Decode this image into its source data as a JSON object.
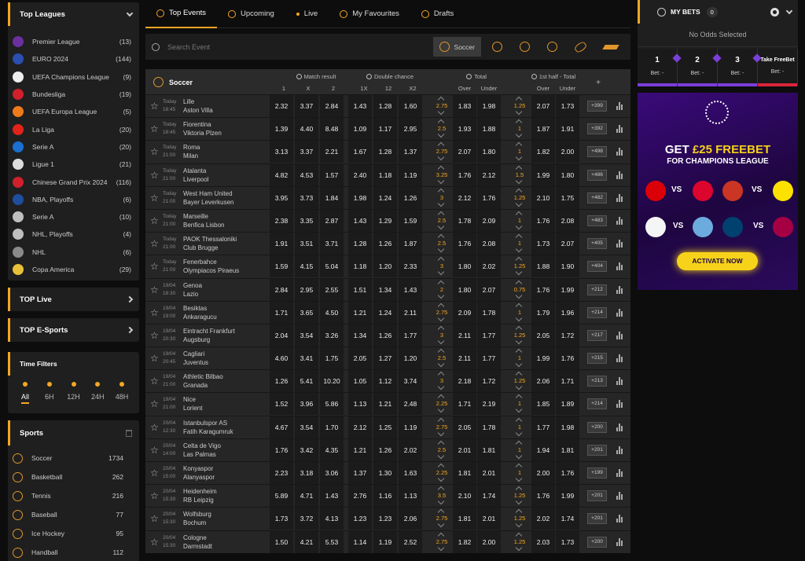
{
  "top_leagues": {
    "title": "Top Leagues",
    "items": [
      {
        "name": "Premier League",
        "count": "(13)",
        "color": "#6b2fa0"
      },
      {
        "name": "EURO 2024",
        "count": "(144)",
        "color": "#2a4fb0"
      },
      {
        "name": "UEFA Champions League",
        "count": "(9)",
        "color": "#eeeeee"
      },
      {
        "name": "Bundesliga",
        "count": "(19)",
        "color": "#d0202a"
      },
      {
        "name": "UEFA Europa League",
        "count": "(5)",
        "color": "#f07a1a"
      },
      {
        "name": "La Liga",
        "count": "(20)",
        "color": "#e2231a"
      },
      {
        "name": "Serie A",
        "count": "(20)",
        "color": "#1a6fd0"
      },
      {
        "name": "Ligue 1",
        "count": "(21)",
        "color": "#dddddd"
      },
      {
        "name": "Chinese Grand Prix 2024",
        "count": "(116)",
        "color": "#d0202a"
      },
      {
        "name": "NBA, Playoffs",
        "count": "(6)",
        "color": "#1d4f9e"
      },
      {
        "name": "Serie A",
        "count": "(10)",
        "color": "#bfbfbf"
      },
      {
        "name": "NHL, Playoffs",
        "count": "(4)",
        "color": "#bfbfbf"
      },
      {
        "name": "NHL",
        "count": "(6)",
        "color": "#8a8a8a"
      },
      {
        "name": "Copa America",
        "count": "(29)",
        "color": "#e8c13a"
      }
    ]
  },
  "top_live": {
    "title": "TOP Live"
  },
  "top_esports": {
    "title": "TOP E-Sports"
  },
  "time_filters": {
    "title": "Time Filters",
    "options": [
      "All",
      "6H",
      "12H",
      "24H",
      "48H"
    ]
  },
  "sports": {
    "title": "Sports",
    "items": [
      {
        "name": "Soccer",
        "count": "1734"
      },
      {
        "name": "Basketball",
        "count": "262"
      },
      {
        "name": "Tennis",
        "count": "216"
      },
      {
        "name": "Baseball",
        "count": "77"
      },
      {
        "name": "Ice Hockey",
        "count": "95"
      },
      {
        "name": "Handball",
        "count": "112"
      }
    ]
  },
  "tabs": [
    "Top Events",
    "Upcoming",
    "Live",
    "My Favourites",
    "Drafts"
  ],
  "search": {
    "placeholder": "Search Event"
  },
  "sport_filter": {
    "active": "Soccer"
  },
  "table": {
    "sport": "Soccer",
    "groups": [
      "Match result",
      "Double chance",
      "Total",
      "1st half - Total"
    ],
    "subheaders": [
      "1",
      "X",
      "2",
      "1X",
      "12",
      "X2",
      "Over",
      "Under",
      "Over",
      "Under"
    ],
    "plus": "+",
    "rows": [
      {
        "date": "Today",
        "time": "18:45",
        "home": "Lille",
        "away": "Aston Villa",
        "o1": "2.32",
        "ox": "3.37",
        "o2": "2.84",
        "d1x": "1.43",
        "d12": "1.28",
        "dx2": "1.60",
        "t": "2.75",
        "to": "1.83",
        "tu": "1.98",
        "h": "1.25",
        "ho": "2.07",
        "hu": "1.73",
        "more": "+399"
      },
      {
        "date": "Today",
        "time": "18:45",
        "home": "Fiorentina",
        "away": "Viktoria Plzen",
        "o1": "1.39",
        "ox": "4.40",
        "o2": "8.48",
        "d1x": "1.09",
        "d12": "1.17",
        "dx2": "2.95",
        "t": "2.5",
        "to": "1.93",
        "tu": "1.88",
        "h": "1",
        "ho": "1.87",
        "hu": "1.91",
        "more": "+392"
      },
      {
        "date": "Today",
        "time": "21:00",
        "home": "Roma",
        "away": "Milan",
        "o1": "3.13",
        "ox": "3.37",
        "o2": "2.21",
        "d1x": "1.67",
        "d12": "1.28",
        "dx2": "1.37",
        "t": "2.75",
        "to": "2.07",
        "tu": "1.80",
        "h": "1",
        "ho": "1.82",
        "hu": "2.00",
        "more": "+498"
      },
      {
        "date": "Today",
        "time": "21:00",
        "home": "Atalanta",
        "away": "Liverpool",
        "o1": "4.82",
        "ox": "4.53",
        "o2": "1.57",
        "d1x": "2.40",
        "d12": "1.18",
        "dx2": "1.19",
        "t": "3.25",
        "to": "1.76",
        "tu": "2.12",
        "h": "1.5",
        "ho": "1.99",
        "hu": "1.80",
        "more": "+486"
      },
      {
        "date": "Today",
        "time": "21:00",
        "home": "West Ham United",
        "away": "Bayer Leverkusen",
        "o1": "3.95",
        "ox": "3.73",
        "o2": "1.84",
        "d1x": "1.98",
        "d12": "1.24",
        "dx2": "1.26",
        "t": "3",
        "to": "2.12",
        "tu": "1.76",
        "h": "1.25",
        "ho": "2.10",
        "hu": "1.75",
        "more": "+482"
      },
      {
        "date": "Today",
        "time": "21:00",
        "home": "Marseille",
        "away": "Benfica Lisbon",
        "o1": "2.38",
        "ox": "3.35",
        "o2": "2.87",
        "d1x": "1.43",
        "d12": "1.29",
        "dx2": "1.59",
        "t": "2.5",
        "to": "1.78",
        "tu": "2.09",
        "h": "1",
        "ho": "1.76",
        "hu": "2.08",
        "more": "+483"
      },
      {
        "date": "Today",
        "time": "21:00",
        "home": "PAOK Thessaloniki",
        "away": "Club Brugge",
        "o1": "1.91",
        "ox": "3.51",
        "o2": "3.71",
        "d1x": "1.28",
        "d12": "1.26",
        "dx2": "1.87",
        "t": "2.5",
        "to": "1.76",
        "tu": "2.08",
        "h": "1",
        "ho": "1.73",
        "hu": "2.07",
        "more": "+405"
      },
      {
        "date": "Today",
        "time": "21:00",
        "home": "Fenerbahce",
        "away": "Olympiacos Piraeus",
        "o1": "1.59",
        "ox": "4.15",
        "o2": "5.04",
        "d1x": "1.18",
        "d12": "1.20",
        "dx2": "2.33",
        "t": "3",
        "to": "1.80",
        "tu": "2.02",
        "h": "1.25",
        "ho": "1.88",
        "hu": "1.90",
        "more": "+404"
      },
      {
        "date": "19/04",
        "time": "18:30",
        "home": "Genoa",
        "away": "Lazio",
        "o1": "2.84",
        "ox": "2.95",
        "o2": "2.55",
        "d1x": "1.51",
        "d12": "1.34",
        "dx2": "1.43",
        "t": "2",
        "to": "1.80",
        "tu": "2.07",
        "h": "0.75",
        "ho": "1.76",
        "hu": "1.99",
        "more": "+212"
      },
      {
        "date": "19/04",
        "time": "19:00",
        "home": "Besiktas",
        "away": "Ankaragucu",
        "o1": "1.71",
        "ox": "3.65",
        "o2": "4.50",
        "d1x": "1.21",
        "d12": "1.24",
        "dx2": "2.11",
        "t": "2.75",
        "to": "2.09",
        "tu": "1.78",
        "h": "1",
        "ho": "1.79",
        "hu": "1.96",
        "more": "+214"
      },
      {
        "date": "19/04",
        "time": "20:30",
        "home": "Eintracht Frankfurt",
        "away": "Augsburg",
        "o1": "2.04",
        "ox": "3.54",
        "o2": "3.26",
        "d1x": "1.34",
        "d12": "1.26",
        "dx2": "1.77",
        "t": "3",
        "to": "2.11",
        "tu": "1.77",
        "h": "1.25",
        "ho": "2.05",
        "hu": "1.72",
        "more": "+217"
      },
      {
        "date": "19/04",
        "time": "20:45",
        "home": "Cagliari",
        "away": "Juventus",
        "o1": "4.60",
        "ox": "3.41",
        "o2": "1.75",
        "d1x": "2.05",
        "d12": "1.27",
        "dx2": "1.20",
        "t": "2.5",
        "to": "2.11",
        "tu": "1.77",
        "h": "1",
        "ho": "1.99",
        "hu": "1.76",
        "more": "+215"
      },
      {
        "date": "19/04",
        "time": "21:00",
        "home": "Athletic Bilbao",
        "away": "Granada",
        "o1": "1.26",
        "ox": "5.41",
        "o2": "10.20",
        "d1x": "1.05",
        "d12": "1.12",
        "dx2": "3.74",
        "t": "3",
        "to": "2.18",
        "tu": "1.72",
        "h": "1.25",
        "ho": "2.06",
        "hu": "1.71",
        "more": "+213"
      },
      {
        "date": "19/04",
        "time": "21:00",
        "home": "Nice",
        "away": "Lorient",
        "o1": "1.52",
        "ox": "3.96",
        "o2": "5.86",
        "d1x": "1.13",
        "d12": "1.21",
        "dx2": "2.48",
        "t": "2.25",
        "to": "1.71",
        "tu": "2.19",
        "h": "1",
        "ho": "1.85",
        "hu": "1.89",
        "more": "+214"
      },
      {
        "date": "20/04",
        "time": "12:30",
        "home": "Istanbulspor AS",
        "away": "Fatih Karagumruk",
        "o1": "4.67",
        "ox": "3.54",
        "o2": "1.70",
        "d1x": "2.12",
        "d12": "1.25",
        "dx2": "1.19",
        "t": "2.75",
        "to": "2.05",
        "tu": "1.78",
        "h": "1",
        "ho": "1.77",
        "hu": "1.98",
        "more": "+200"
      },
      {
        "date": "20/04",
        "time": "14:00",
        "home": "Celta de Vigo",
        "away": "Las Palmas",
        "o1": "1.76",
        "ox": "3.42",
        "o2": "4.35",
        "d1x": "1.21",
        "d12": "1.26",
        "dx2": "2.02",
        "t": "2.5",
        "to": "2.01",
        "tu": "1.81",
        "h": "1",
        "ho": "1.94",
        "hu": "1.81",
        "more": "+201"
      },
      {
        "date": "20/04",
        "time": "15:00",
        "home": "Konyaspor",
        "away": "Alanyaspor",
        "o1": "2.23",
        "ox": "3.18",
        "o2": "3.06",
        "d1x": "1.37",
        "d12": "1.30",
        "dx2": "1.63",
        "t": "2.25",
        "to": "1.81",
        "tu": "2.01",
        "h": "1",
        "ho": "2.00",
        "hu": "1.76",
        "more": "+199"
      },
      {
        "date": "20/04",
        "time": "15:30",
        "home": "Heidenheim",
        "away": "RB Leipzig",
        "o1": "5.89",
        "ox": "4.71",
        "o2": "1.43",
        "d1x": "2.76",
        "d12": "1.16",
        "dx2": "1.13",
        "t": "3.5",
        "to": "2.10",
        "tu": "1.74",
        "h": "1.25",
        "ho": "1.76",
        "hu": "1.99",
        "more": "+201"
      },
      {
        "date": "20/04",
        "time": "15:30",
        "home": "Wolfsburg",
        "away": "Bochum",
        "o1": "1.73",
        "ox": "3.72",
        "o2": "4.13",
        "d1x": "1.23",
        "d12": "1.23",
        "dx2": "2.06",
        "t": "2.75",
        "to": "1.81",
        "tu": "2.01",
        "h": "1.25",
        "ho": "2.02",
        "hu": "1.74",
        "more": "+201"
      },
      {
        "date": "20/04",
        "time": "15:30",
        "home": "Cologne",
        "away": "Darmstadt",
        "o1": "1.50",
        "ox": "4.21",
        "o2": "5.53",
        "d1x": "1.14",
        "d12": "1.19",
        "dx2": "2.52",
        "t": "2.75",
        "to": "1.82",
        "tu": "2.00",
        "h": "1.25",
        "ho": "2.03",
        "hu": "1.73",
        "more": "+200"
      }
    ]
  },
  "bet_slip": {
    "title": "MY BETS",
    "count": "0",
    "empty": "No Odds Selected",
    "tabs": [
      {
        "num": "1",
        "bet": "Bet: -"
      },
      {
        "num": "2",
        "bet": "Bet: -"
      },
      {
        "num": "3",
        "bet": "Bet: -"
      },
      {
        "num": "Take FreeBet",
        "bet": "Bet: -"
      }
    ]
  },
  "promo": {
    "headline_pre": "GET ",
    "headline_amount": "£25 FREEBET",
    "subline": "FOR CHAMPIONS LEAGUE",
    "vs": "VS",
    "button": "ACTIVATE NOW",
    "crests": [
      "arsenal-crest",
      "bayern-crest",
      "atletico-crest",
      "dortmund-crest",
      "real-madrid-crest",
      "man-city-crest",
      "psg-crest",
      "barcelona-crest"
    ],
    "crest_colors": [
      "#db0007",
      "#dc052d",
      "#cb3524",
      "#fde100",
      "#f5f5f5",
      "#6cabdd",
      "#004170",
      "#a50044"
    ]
  },
  "colors": {
    "accent": "#f5a623",
    "promo_yellow": "#f7d21a",
    "slip_purple": "#7b3fd9",
    "slip_red": "#d9253b"
  }
}
